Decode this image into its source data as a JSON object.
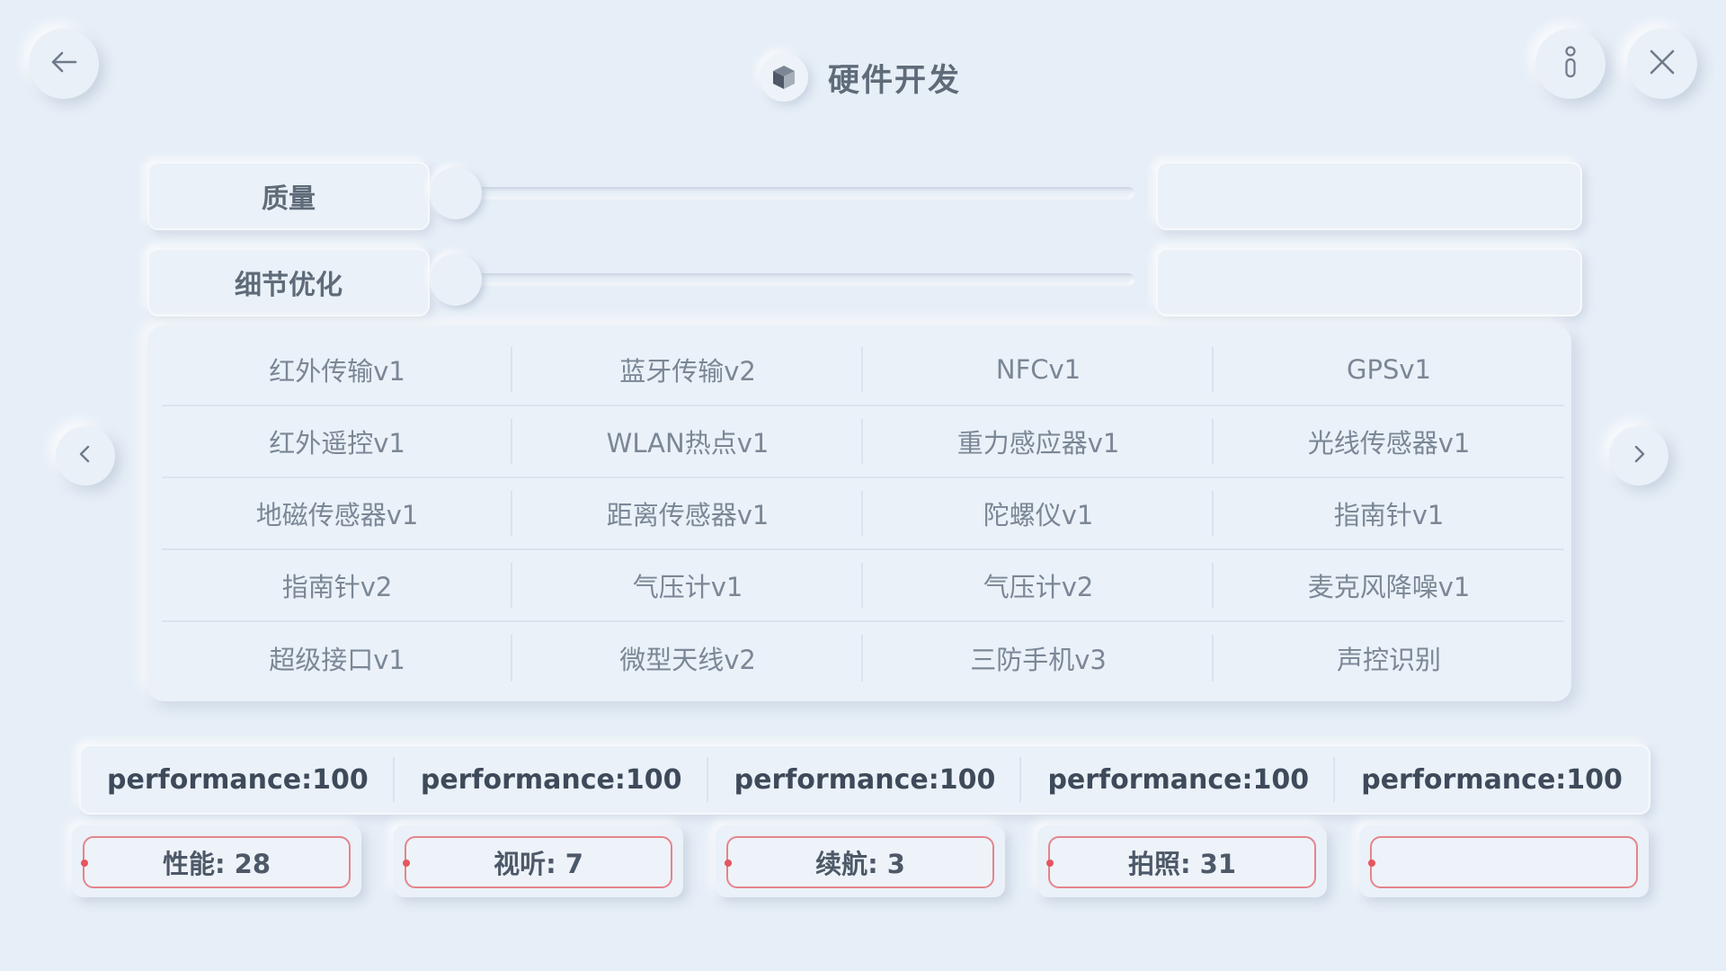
{
  "header": {
    "title": "硬件开发",
    "back_icon": "arrow-left-icon",
    "logo_icon": "cube-icon",
    "info_icon": "info-icon",
    "close_icon": "close-icon"
  },
  "sliders": [
    {
      "label": "质量",
      "value": 0,
      "value_text": ""
    },
    {
      "label": "细节优化",
      "value": 0,
      "value_text": ""
    }
  ],
  "modules": [
    "红外传输v1",
    "蓝牙传输v2",
    "NFCv1",
    "GPSv1",
    "红外遥控v1",
    "WLAN热点v1",
    "重力感应器v1",
    "光线传感器v1",
    "地磁传感器v1",
    "距离传感器v1",
    "陀螺仪v1",
    "指南针v1",
    "指南针v2",
    "气压计v1",
    "气压计v2",
    "麦克风降噪v1",
    "超级接口v1",
    "微型天线v2",
    "三防手机v3",
    "声控识别"
  ],
  "performance": [
    "performance:100",
    "performance:100",
    "performance:100",
    "performance:100",
    "performance:100"
  ],
  "stats": [
    "性能: 28",
    "视听: 7",
    "续航: 3",
    "拍照: 31",
    ""
  ],
  "colors": {
    "background": "#e6eef7",
    "accent_border": "#e5848b",
    "accent_dot": "#e5565f",
    "text_dark": "#3e4a5a"
  }
}
